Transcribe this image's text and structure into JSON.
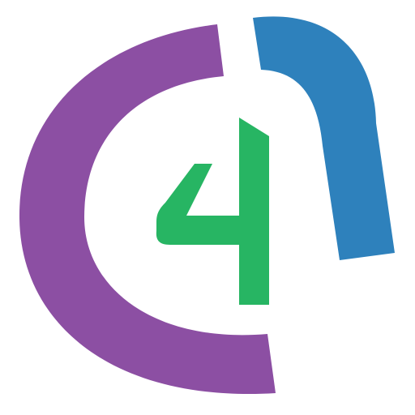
{
  "logo": {
    "text": "4",
    "colors": {
      "background": "#FFFFFF",
      "c_arc": "#8C4FA3",
      "n_arch": "#2E81BC",
      "four": "#27B563"
    }
  }
}
